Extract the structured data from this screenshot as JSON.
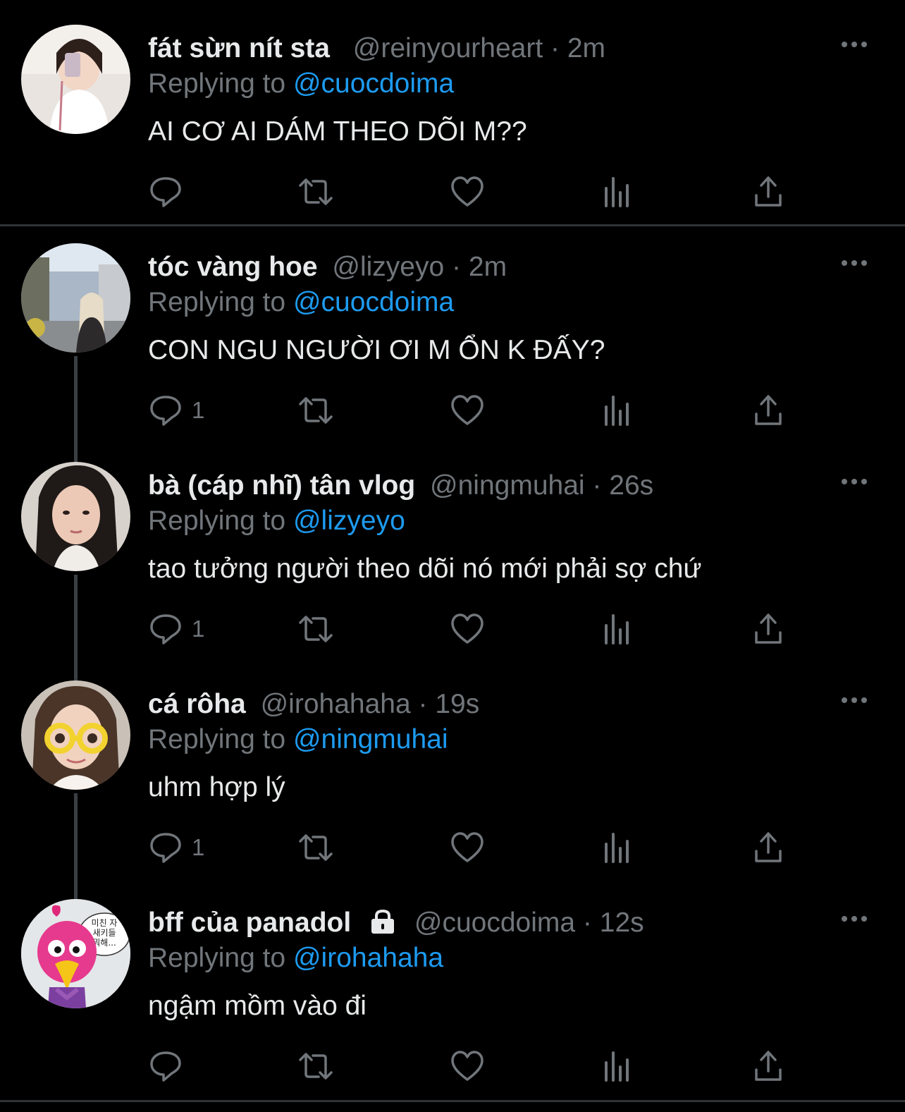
{
  "colors": {
    "background": "#000000",
    "primary_text": "#e7e9ea",
    "secondary_text": "#71767b",
    "mention": "#1d9bf0",
    "divider": "#2f3336"
  },
  "tweets": [
    {
      "name": "fát sừn nít sta",
      "handle": "@reinyourheart",
      "separator": "·",
      "time": "2m",
      "replying_label": "Replying to",
      "replying_to": "@cuocdoima",
      "text": "AI CƠ AI DÁM THEO DÕI M??",
      "reply_count": "",
      "locked": false,
      "icons": [
        "reply-icon",
        "retweet-icon",
        "like-icon",
        "views-icon",
        "share-icon"
      ]
    },
    {
      "name": "tóc vàng hoe",
      "handle": "@lizyeyo",
      "separator": "·",
      "time": "2m",
      "replying_label": "Replying to",
      "replying_to": "@cuocdoima",
      "text": "CON NGU NGƯỜI ƠI M ỔN K ĐẤY?",
      "reply_count": "1",
      "locked": false,
      "icons": [
        "reply-icon",
        "retweet-icon",
        "like-icon",
        "views-icon",
        "share-icon"
      ]
    },
    {
      "name": "bà (cáp nhĩ) tân vlog",
      "handle": "@ningmuhai",
      "separator": "·",
      "time": "26s",
      "replying_label": "Replying to",
      "replying_to": "@lizyeyo",
      "text": "tao tưởng người theo dõi nó mới phải sợ chứ",
      "reply_count": "1",
      "locked": false,
      "icons": [
        "reply-icon",
        "retweet-icon",
        "like-icon",
        "views-icon",
        "share-icon"
      ]
    },
    {
      "name": "cá rôha",
      "handle": "@irohahaha",
      "separator": "·",
      "time": "19s",
      "replying_label": "Replying to",
      "replying_to": "@ningmuhai",
      "text": "uhm hợp lý",
      "reply_count": "1",
      "locked": false,
      "icons": [
        "reply-icon",
        "retweet-icon",
        "like-icon",
        "views-icon",
        "share-icon"
      ]
    },
    {
      "name": "bff của panadol",
      "handle": "@cuocdoima",
      "separator": "·",
      "time": "12s",
      "replying_label": "Replying to",
      "replying_to": "@irohahaha",
      "text": "ngậm mồm vào đi",
      "reply_count": "",
      "locked": true,
      "avatar_text": [
        "미친 자",
        "새키들",
        "뭐해..."
      ],
      "icons": [
        "reply-icon",
        "retweet-icon",
        "like-icon",
        "views-icon",
        "share-icon"
      ]
    }
  ]
}
